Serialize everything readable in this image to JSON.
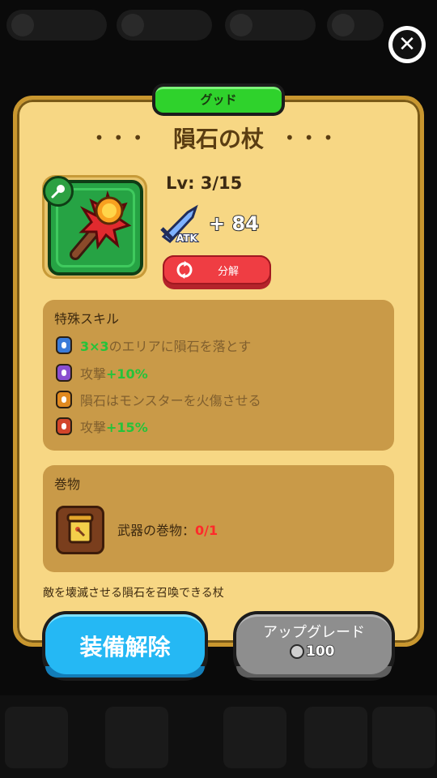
{
  "rarity": "グッド",
  "item": {
    "name": "隕石の杖",
    "level": "Lv: 3/15",
    "atk_label": "ATK",
    "atk_bonus": "+ 84",
    "description": "敵を壊滅させる隕石を召喚できる杖",
    "icon": "meteor-staff-icon"
  },
  "dismantle_label": "分解",
  "skills": {
    "title": "特殊スキル",
    "items": [
      {
        "highlight": "3×3",
        "text": "のエリアに隕石を落とす",
        "prefix": "",
        "lock_color": "#3b7bd8"
      },
      {
        "prefix": "攻撃",
        "highlight": "+10%",
        "text": "",
        "lock_color": "#8a4fd0"
      },
      {
        "prefix": "隕石はモンスターを火傷させる",
        "highlight": "",
        "text": "",
        "lock_color": "#e0891f"
      },
      {
        "prefix": "攻撃",
        "highlight": "+15%",
        "text": "",
        "lock_color": "#d2452b"
      }
    ]
  },
  "scroll": {
    "title": "巻物",
    "label": "武器の巻物：",
    "count": "0/1"
  },
  "buttons": {
    "unequip": "装備解除",
    "upgrade": "アップグレード",
    "upgrade_cost": "100"
  }
}
